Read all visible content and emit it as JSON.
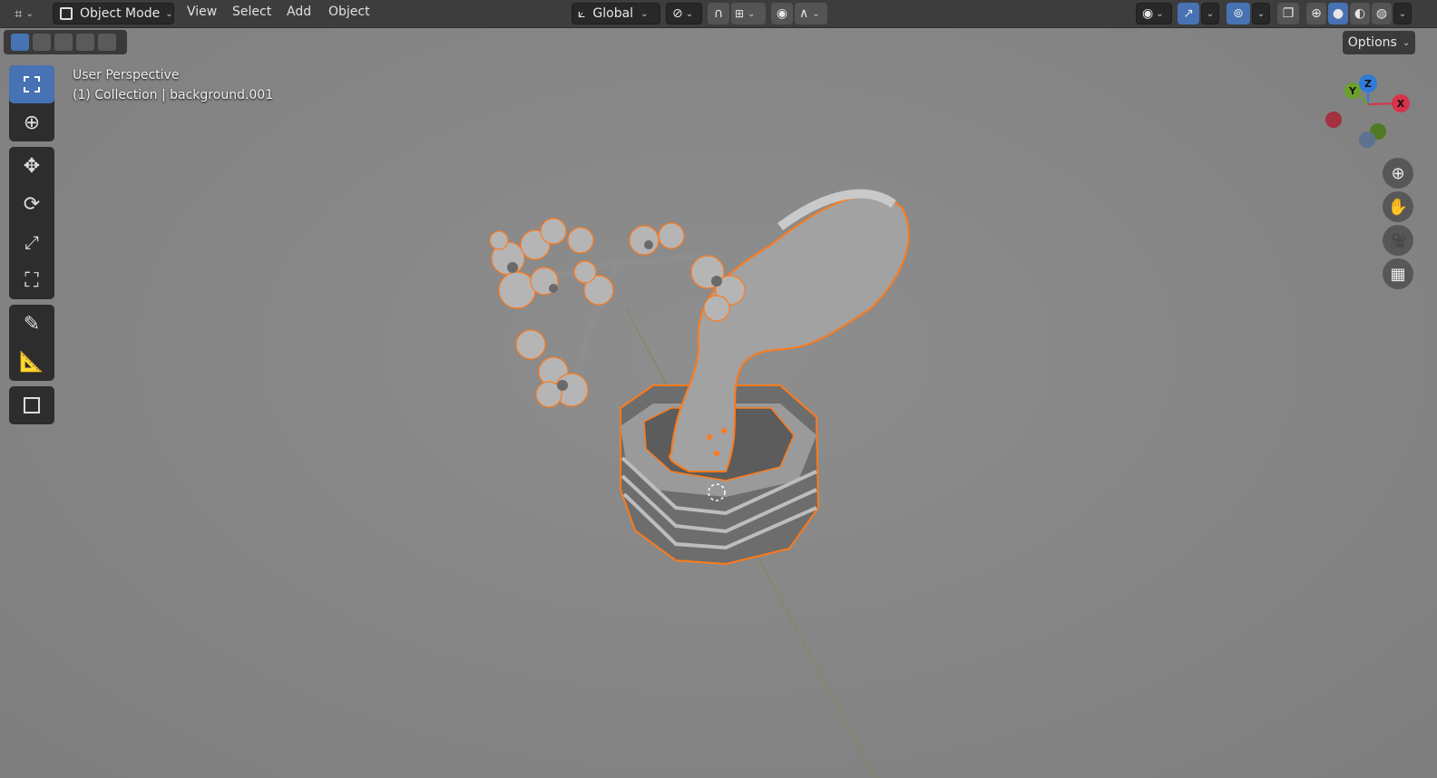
{
  "header": {
    "mode_label": "Object Mode",
    "menus": [
      "View",
      "Select",
      "Add",
      "Object"
    ],
    "orientation_label": "Global"
  },
  "tool_settings": {
    "options_label": "Options"
  },
  "viewport": {
    "view_name": "User Perspective",
    "collection_info": "(1) Collection | background.001"
  },
  "gizmo": {
    "z_label": "Z",
    "y_label": "Y",
    "x_label": "X"
  },
  "colors": {
    "header_bg": "#3d3d3d",
    "viewport_bg": "#878787",
    "active_blue": "#4772b3",
    "selection_orange": "#ff7a1a",
    "axis_x": "#d6344a",
    "axis_y": "#6aa12b",
    "axis_z": "#2f7bd8"
  },
  "icons": [
    "editor-type-icon",
    "object-mode-icon",
    "transform-orientation-icon",
    "pivot-point-icon",
    "snap-icon",
    "snap-increment-icon",
    "proportional-edit-icon",
    "falloff-icon",
    "visibility-icon",
    "gizmo-icon",
    "overlay-icon",
    "xray-icon",
    "wireframe-shading-icon",
    "solid-shading-icon",
    "material-shading-icon",
    "rendered-shading-icon",
    "select-box-icon",
    "cursor-icon",
    "move-icon",
    "rotate-icon",
    "scale-icon",
    "transform-icon",
    "annotate-icon",
    "measure-icon",
    "add-cube-icon",
    "zoom-icon",
    "pan-hand-icon",
    "camera-icon",
    "grid-perspective-icon"
  ]
}
